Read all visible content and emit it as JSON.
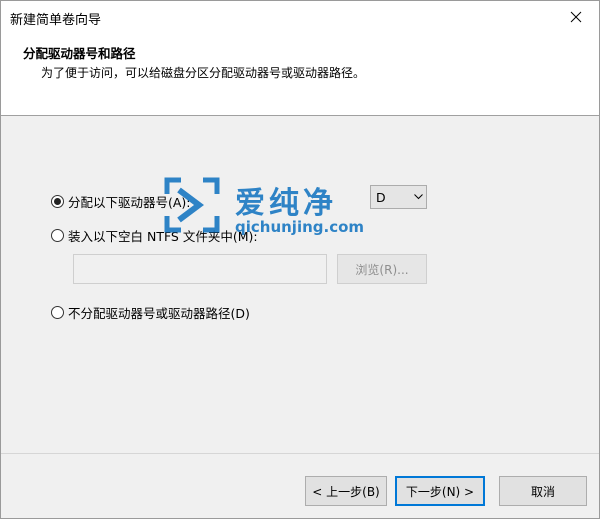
{
  "window": {
    "title": "新建简单卷向导"
  },
  "header": {
    "title": "分配驱动器号和路径",
    "subtitle": "为了便于访问，可以给磁盘分区分配驱动器号或驱动器路径。"
  },
  "options": {
    "assign_letter": {
      "label": "分配以下驱动器号(A):",
      "selected": true
    },
    "mount_folder": {
      "label": "装入以下空白 NTFS 文件夹中(M):",
      "selected": false
    },
    "no_assign": {
      "label": "不分配驱动器号或驱动器路径(D)",
      "selected": false
    }
  },
  "drive_letter": {
    "value": "D"
  },
  "folder_path": {
    "value": ""
  },
  "browse_label": "浏览(R)...",
  "watermark": {
    "text": "爱纯净",
    "url": "qichunjing.com"
  },
  "footer": {
    "back_label": "< 上一步(B)",
    "next_label": "下一步(N) >",
    "cancel_label": "取消"
  },
  "colors": {
    "accent": "#0078d7",
    "watermark": "#1a78c2"
  }
}
